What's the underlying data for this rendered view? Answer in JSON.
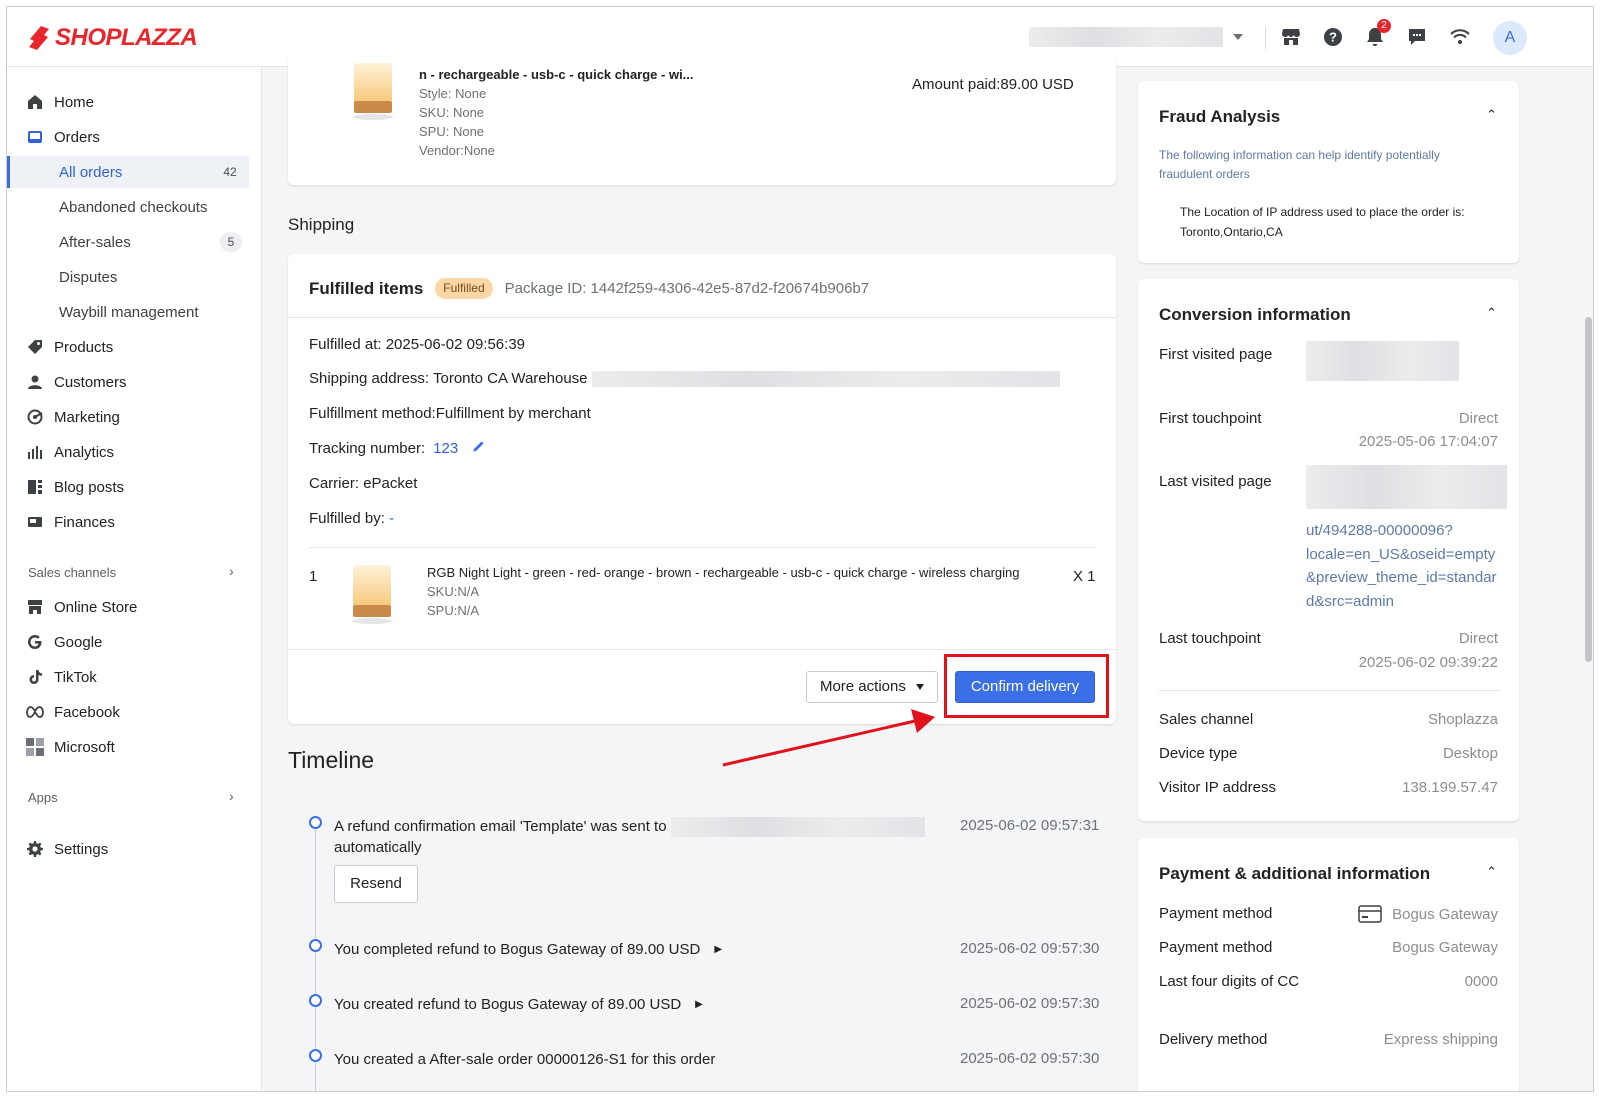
{
  "brand": {
    "logo_text": "SHOPLAZZA",
    "accent": "#e8262b",
    "primary": "#3b6fe8"
  },
  "header": {
    "notification_count": "2",
    "avatar_letter": "A"
  },
  "sidebar": {
    "items": {
      "home": "Home",
      "orders": "Orders",
      "all_orders": "All orders",
      "all_orders_count": "42",
      "abandoned_checkouts": "Abandoned checkouts",
      "after_sales": "After-sales",
      "after_sales_count": "5",
      "disputes": "Disputes",
      "waybill_management": "Waybill management",
      "products": "Products",
      "customers": "Customers",
      "marketing": "Marketing",
      "analytics": "Analytics",
      "blog_posts": "Blog posts",
      "finances": "Finances",
      "online_store": "Online Store",
      "google": "Google",
      "tiktok": "TikTok",
      "facebook": "Facebook",
      "microsoft": "Microsoft",
      "settings": "Settings"
    },
    "sections": {
      "sales_channels": "Sales channels",
      "apps": "Apps"
    }
  },
  "top_product": {
    "title": "n - rechargeable - usb-c - quick charge - wi...",
    "style": "Style: None",
    "sku": "SKU: None",
    "spu": "SPU: None",
    "vendor": "Vendor:None",
    "amount_paid": "Amount paid:89.00 USD"
  },
  "shipping": {
    "section_title": "Shipping",
    "card_title": "Fulfilled items",
    "status_badge": "Fulfilled",
    "package_id": "Package ID: 1442f259-4306-42e5-87d2-f20674b906b7",
    "fulfilled_at_label": "Fulfilled at:",
    "fulfilled_at_value": "2025-06-02 09:56:39",
    "shipping_address": "Shipping address: Toronto CA Warehouse",
    "fulfillment_method": "Fulfillment method:Fulfillment by merchant",
    "tracking_label": "Tracking number:",
    "tracking_value": "123",
    "carrier_label": "Carrier:",
    "carrier_value": "ePacket",
    "fulfilled_by_label": "Fulfilled by:",
    "fulfilled_by_value": "-",
    "line_item": {
      "index": "1",
      "title": "RGB Night Light - green - red- orange - brown - rechargeable - usb-c - quick charge - wireless charging",
      "sku": "SKU:N/A",
      "spu": "SPU:N/A",
      "quantity": "X 1"
    },
    "more_actions_label": "More actions",
    "confirm_delivery_label": "Confirm delivery"
  },
  "timeline": {
    "title": "Timeline",
    "events": [
      {
        "text": "A refund confirmation email 'Template' was sent to",
        "text2": "automatically",
        "time": "2025-06-02 09:57:31",
        "button": "Resend"
      },
      {
        "text": "You completed refund to Bogus Gateway of 89.00 USD",
        "time": "2025-06-02 09:57:30"
      },
      {
        "text": "You created refund to Bogus Gateway of 89.00 USD",
        "time": "2025-06-02 09:57:30"
      },
      {
        "text": "You created a After-sale order 00000126-S1 for this order",
        "time": "2025-06-02 09:57:30"
      }
    ]
  },
  "fraud": {
    "title": "Fraud Analysis",
    "description": "The following information can help identify potentially fraudulent orders",
    "ip_line1": "The Location of IP address used to place the order is:",
    "ip_line2": "Toronto,Ontario,CA"
  },
  "conversion": {
    "title": "Conversion information",
    "first_visited_label": "First visited page",
    "first_touchpoint_label": "First touchpoint",
    "first_touchpoint_value": "Direct",
    "first_touchpoint_time": "2025-05-06 17:04:07",
    "last_visited_label": "Last visited page",
    "last_visited_url": [
      "ut/494288-00000096?",
      "locale=en_US&oseid=empty",
      "&preview_theme_id=standar",
      "d&src=admin"
    ],
    "last_touchpoint_label": "Last touchpoint",
    "last_touchpoint_value": "Direct",
    "last_touchpoint_time": "2025-06-02 09:39:22",
    "sales_channel_label": "Sales channel",
    "sales_channel_value": "Shoplazza",
    "device_type_label": "Device type",
    "device_type_value": "Desktop",
    "visitor_ip_label": "Visitor IP address",
    "visitor_ip_value": "138.199.57.47"
  },
  "payment": {
    "title": "Payment & additional information",
    "rows": [
      {
        "label": "Payment method",
        "value": "Bogus Gateway"
      },
      {
        "label": "Payment method",
        "value": "Bogus Gateway"
      },
      {
        "label": "Last four digits of CC",
        "value": "0000"
      },
      {
        "label": "Delivery method",
        "value": "Express shipping"
      }
    ]
  },
  "annotation": {
    "highlight_color": "#e0131b"
  }
}
